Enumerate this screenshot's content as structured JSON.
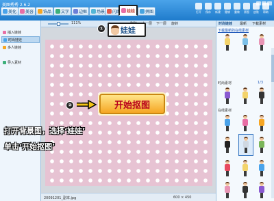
{
  "app": {
    "title": "美图秀秀 2.6.2"
  },
  "tabs": [
    {
      "label": "美化",
      "color": "#4aa3ea"
    },
    {
      "label": "美容",
      "color": "#e86fa5"
    },
    {
      "label": "饰品",
      "color": "#f6a623"
    },
    {
      "label": "文字",
      "color": "#3db07a"
    },
    {
      "label": "边框",
      "color": "#6c7fd8"
    },
    {
      "label": "场景",
      "color": "#55b6d6"
    },
    {
      "label": "闪图",
      "color": "#e25b4b"
    },
    {
      "label": "娃娃",
      "color": "#e86fa5"
    },
    {
      "label": "拼图",
      "color": "#47a4e0"
    }
  ],
  "toolbar": {
    "buttons": [
      {
        "label": "打开",
        "icon": "folder-icon"
      },
      {
        "label": "保存",
        "icon": "save-icon"
      },
      {
        "label": "新建",
        "icon": "new-icon"
      },
      {
        "label": "撤销",
        "icon": "undo-icon"
      },
      {
        "label": "重做",
        "icon": "redo-icon"
      },
      {
        "label": "原图",
        "icon": "original-icon"
      },
      {
        "label": "皮肤",
        "icon": "skin-icon"
      },
      {
        "label": "帮助",
        "icon": "help-icon"
      }
    ]
  },
  "subbar": {
    "zoom": "111%",
    "delete_label": "删除",
    "prev_label": "上一层",
    "next_label": "下一层",
    "rotate_label": "旋转"
  },
  "left_panel": {
    "items": [
      {
        "label": "插入娃娃",
        "selected": false,
        "color": "#e86fa5"
      },
      {
        "label": "时尚娃娃",
        "selected": true,
        "color": "#4aa3ea"
      },
      {
        "label": "多人娃娃",
        "selected": false,
        "color": "#f6a623"
      },
      {
        "label": "导入素材",
        "selected": false,
        "color": "#3db07a"
      }
    ]
  },
  "callouts": {
    "step1_num": "①",
    "step1_text": "娃娃",
    "step2_num": "②",
    "step2_text": "开始抠图"
  },
  "instructions": {
    "line1": "打开背景图，选择‘娃娃’",
    "line2": "单击‘开始抠图’"
  },
  "status": {
    "filename": "20091201_副本.jpg",
    "size": "600 × 450"
  },
  "right_panel": {
    "tabs": [
      "时尚娃娃",
      "最新",
      "下载素材"
    ],
    "link": "下载最新的在线素材",
    "section1": "时尚素材",
    "section2": "在线素材",
    "page_nav": "1/3"
  }
}
